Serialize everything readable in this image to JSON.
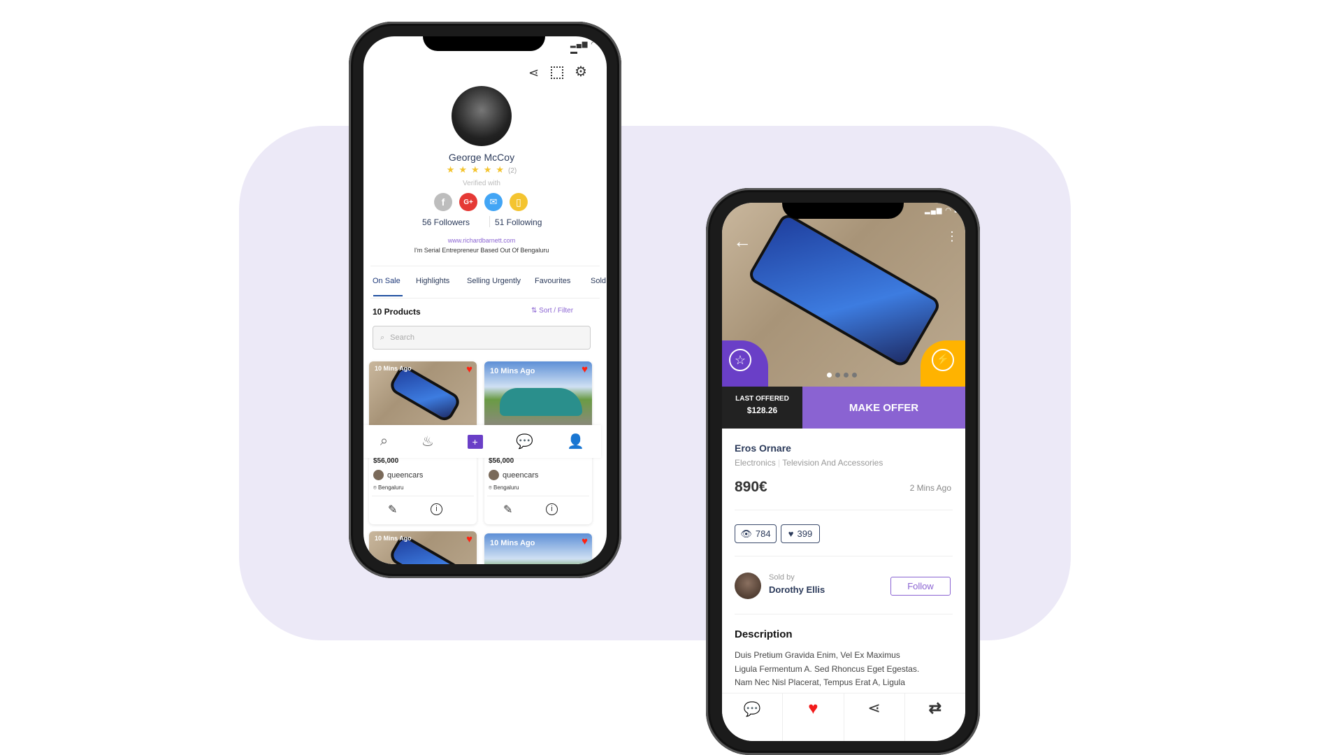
{
  "profile_screen": {
    "header_icons": [
      "share-icon",
      "qr-code-icon",
      "gear-icon"
    ],
    "user": {
      "name": "George McCoy",
      "rating": 5,
      "rating_count": "(2)",
      "verified_label": "Verified with",
      "followers": "56 Followers",
      "following": "51 Following",
      "website": "www.richardbarnett.com",
      "bio": "I'm Serial Entrepreneur Based Out Of Bengaluru"
    },
    "verified_icons": [
      {
        "icon": "facebook-icon",
        "glyph": "f",
        "color": "#bdbdbd"
      },
      {
        "icon": "google-plus-icon",
        "glyph": "G+",
        "color": "#e53935"
      },
      {
        "icon": "email-icon",
        "glyph": "✉",
        "color": "#42a5f5"
      },
      {
        "icon": "phone-icon",
        "glyph": "▯",
        "color": "#f4c430"
      }
    ],
    "tabs": [
      {
        "label": "On Sale",
        "active": true
      },
      {
        "label": "Highlights"
      },
      {
        "label": "Selling Urgently"
      },
      {
        "label": "Favourites"
      },
      {
        "label": "Sold"
      }
    ],
    "products_count": "10 Products",
    "sort_filter": "Sort / Filter",
    "search_placeholder": "Search",
    "products": [
      {
        "time": "10 Mins Ago",
        "price": "$56,000",
        "seller": "queencars",
        "location": "Bengaluru",
        "image": "phone"
      },
      {
        "time": "10 Mins Ago",
        "price": "$56,000",
        "seller": "queencars",
        "location": "Bengaluru",
        "image": "car"
      },
      {
        "time": "10 Mins Ago",
        "image": "phone"
      },
      {
        "time": "10 Mins Ago",
        "image": "car"
      }
    ],
    "bottom_nav": [
      "search-icon",
      "flame-icon",
      "add-icon",
      "chat-icon",
      "profile-icon"
    ],
    "add_glyph": "+"
  },
  "product_screen": {
    "image_pages": 4,
    "active_page": 1,
    "last_offered_label": "LAST OFFERED",
    "last_offered_value": "$128.26",
    "make_offer": "MAKE OFFER",
    "title": "Eros Ornare",
    "category": "Electronics",
    "subcategory": "Television And Accessories",
    "price": "890€",
    "posted": "2 Mins Ago",
    "views": "784",
    "likes": "399",
    "sold_by_label": "Sold by",
    "seller": "Dorothy Ellis",
    "follow": "Follow",
    "description_title": "Description",
    "description_lines": [
      "Duis Pretium Gravida Enim, Vel Ex Maximus",
      "Ligula Fermentum A. Sed Rhoncus Eget Egestas.",
      "Nam Nec Nisl Placerat, Tempus Erat A, Ligula"
    ],
    "bottom_actions": [
      "chat-icon",
      "heart-icon",
      "share-icon",
      "swap-icon"
    ]
  },
  "colors": {
    "accent": "#8a63d2",
    "background": "#ece9f7",
    "badge_yellow": "#ffb300",
    "heart": "#f21b1b",
    "navy": "#2b3a5a"
  }
}
